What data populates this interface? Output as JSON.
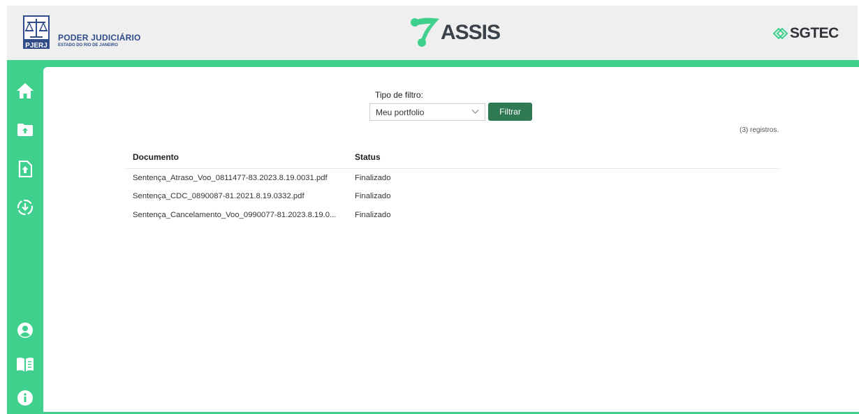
{
  "header": {
    "org_title": "PODER JUDICIÁRIO",
    "org_subtitle": "ESTADO DO RIO DE JANEIRO",
    "org_abbrev": "PJERJ",
    "app_name": "ASSIS",
    "partner_name": "SGTEC"
  },
  "colors": {
    "accent_green": "#3fd08e",
    "button_green": "#2f7a52",
    "org_blue": "#2f4b8a"
  },
  "sidebar": {
    "icons": [
      "home-icon",
      "folder-upload-icon",
      "file-upload-icon",
      "download-circle-icon",
      "user-icon",
      "book-icon",
      "info-icon"
    ]
  },
  "filter": {
    "label": "Tipo de filtro:",
    "selected": "Meu portfolio",
    "button_label": "Filtrar"
  },
  "records_count": "(3) registros.",
  "table": {
    "columns": [
      "Documento",
      "Status"
    ],
    "rows": [
      {
        "documento": "Sentença_Atraso_Voo_0811477-83.2023.8.19.0031.pdf",
        "status": "Finalizado"
      },
      {
        "documento": "Sentença_CDC_0890087-81.2021.8.19.0332.pdf",
        "status": "Finalizado"
      },
      {
        "documento": "Sentença_Cancelamento_Voo_0990077-81.2023.8.19.0...",
        "status": "Finalizado"
      }
    ]
  }
}
